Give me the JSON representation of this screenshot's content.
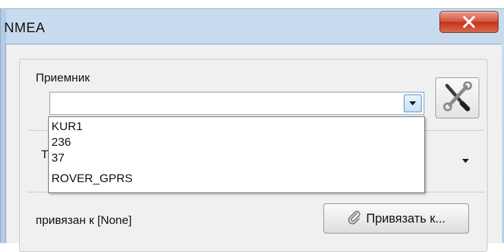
{
  "window": {
    "title": "NMEA",
    "close_icon": "close-x-icon"
  },
  "receiver": {
    "label": "Приемник",
    "selected_value": "",
    "settings_icon": "tools-wrench-screwdriver-icon",
    "dropdown_items": [
      "KUR1",
      "236",
      "37",
      "ROVER_GPRS"
    ]
  },
  "type_row": {
    "partial_label": "Т"
  },
  "binding": {
    "status_text": "привязан к [None]",
    "button_label": "Привязать к...",
    "button_icon": "paperclip-icon"
  }
}
